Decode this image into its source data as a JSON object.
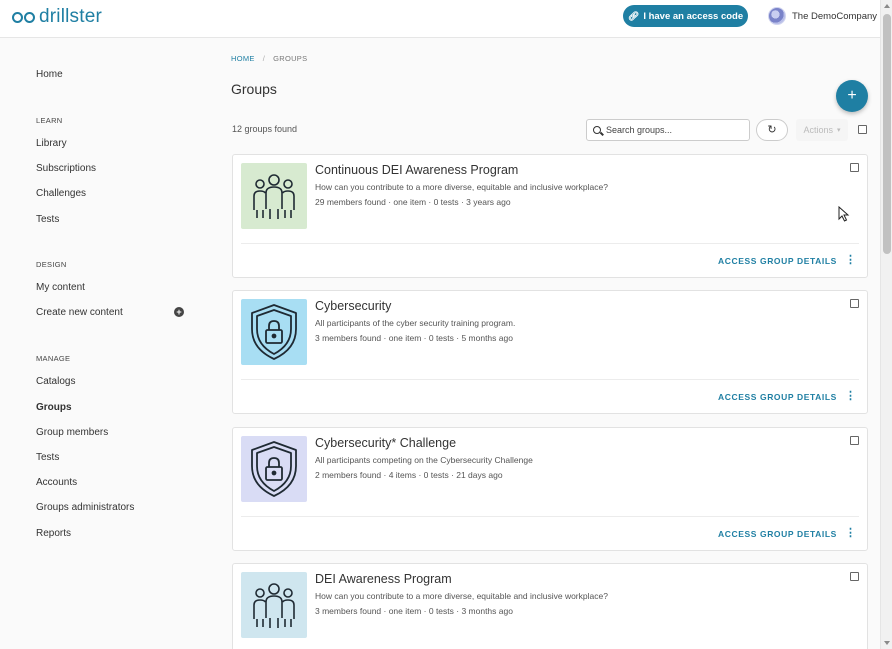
{
  "header": {
    "logo_text": "drillster",
    "access_button": "I have an access code",
    "company": "The DemoCompany"
  },
  "sidebar": {
    "home": "Home",
    "sections": {
      "learn": "LEARN",
      "design": "DESIGN",
      "manage": "MANAGE"
    },
    "learn_items": [
      "Library",
      "Subscriptions",
      "Challenges",
      "Tests"
    ],
    "design_items": [
      "My content",
      "Create new content"
    ],
    "manage_items": [
      "Catalogs",
      "Groups",
      "Group members",
      "Tests",
      "Accounts",
      "Groups administrators",
      "Reports"
    ],
    "active": "Groups"
  },
  "breadcrumb": {
    "home": "HOME",
    "separator": "/",
    "current": "GROUPS"
  },
  "page": {
    "title": "Groups",
    "count": "12 groups found",
    "fab_label": "+",
    "search_placeholder": "Search groups...",
    "actions_label": "Actions"
  },
  "groups": [
    {
      "title": "Continuous DEI Awareness Program",
      "description": "How can you contribute to a more diverse, equitable and inclusive workplace?",
      "meta": "29 members found · one item · 0 tests · 3 years ago",
      "details": "ACCESS GROUP DETAILS",
      "icon": "people-icon",
      "thumb_color": "#d7ead0"
    },
    {
      "title": "Cybersecurity",
      "description": "All participants of the cyber security training program.",
      "meta": "3 members found · one item · 0 tests · 5 months ago",
      "details": "ACCESS GROUP DETAILS",
      "icon": "shield-lock-icon",
      "thumb_color": "#a8def3"
    },
    {
      "title": "Cybersecurity* Challenge",
      "description": "All participants competing on the Cybersecurity Challenge",
      "meta": "2 members found · 4 items · 0 tests · 21 days ago",
      "details": "ACCESS GROUP DETAILS",
      "icon": "shield-lock-icon",
      "thumb_color": "#d9dcf5"
    },
    {
      "title": "DEI Awareness Program",
      "description": "How can you contribute to a more diverse, equitable and inclusive workplace?",
      "meta": "3 members found · one item · 0 tests · 3 months ago",
      "details": "ACCESS GROUP DETAILS",
      "icon": "people-icon",
      "thumb_color": "#cfe6ef"
    }
  ],
  "colors": {
    "accent": "#1f7fa3"
  }
}
